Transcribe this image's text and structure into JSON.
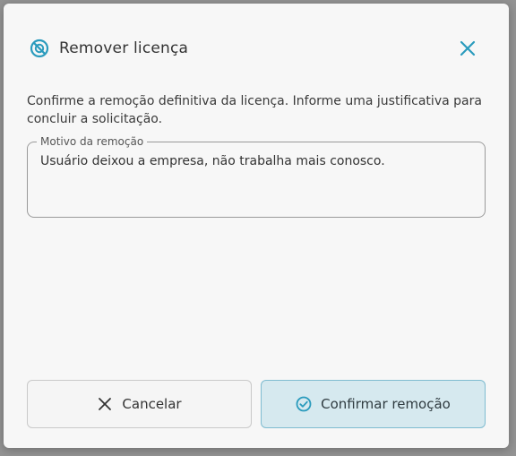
{
  "dialog": {
    "title": "Remover licença",
    "description": "Confirme a remoção definitiva da licença. Informe uma justificativa para concluir a solicitação.",
    "reason_field": {
      "label": "Motivo da remoção",
      "value": "Usuário deixou a empresa, não trabalha mais conosco."
    },
    "cancel_label": "Cancelar",
    "confirm_label": "Confirmar remoção"
  },
  "colors": {
    "accent": "#2a9bbd",
    "confirm_bg": "#d6e9ef",
    "confirm_border": "#7fbcd0"
  },
  "icons": {
    "title_icon": "blocked-circle-icon",
    "close_icon": "close-icon",
    "cancel_icon": "x-icon",
    "confirm_icon": "check-circle-icon"
  }
}
